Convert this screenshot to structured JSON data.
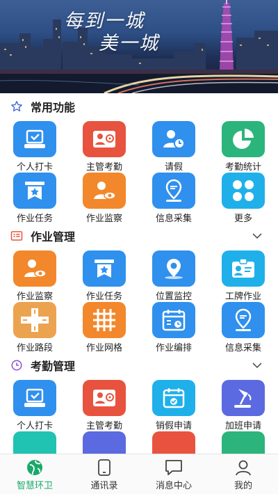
{
  "banner": {
    "slogan_line1": "每到一城",
    "slogan_line2": "美一城"
  },
  "sections": [
    {
      "title": "常用功能",
      "icon": "star-outline-icon",
      "collapsible": false,
      "items": [
        {
          "label": "个人打卡",
          "icon": "punch-in-icon",
          "color": "#2f90ee"
        },
        {
          "label": "主管考勤",
          "icon": "supervisor-attendance-icon",
          "color": "#e8533f"
        },
        {
          "label": "请假",
          "icon": "leave-request-icon",
          "color": "#2f90ee"
        },
        {
          "label": "考勤统计",
          "icon": "pie-chart-icon",
          "color": "#2bb47b"
        },
        {
          "label": "作业任务",
          "icon": "task-flag-icon",
          "color": "#2f90ee"
        },
        {
          "label": "作业监察",
          "icon": "inspection-icon",
          "color": "#f3872b"
        },
        {
          "label": "信息采集",
          "icon": "info-collect-icon",
          "color": "#2f90ee"
        },
        {
          "label": "更多",
          "icon": "more-grid-icon",
          "color": "#1fb0ea"
        }
      ]
    },
    {
      "title": "作业管理",
      "icon": "list-card-icon",
      "collapsible": true,
      "items": [
        {
          "label": "作业监察",
          "icon": "inspection-icon",
          "color": "#f3872b"
        },
        {
          "label": "作业任务",
          "icon": "task-flag-icon",
          "color": "#2f90ee"
        },
        {
          "label": "位置监控",
          "icon": "location-monitor-icon",
          "color": "#2f90ee"
        },
        {
          "label": "工牌作业",
          "icon": "badge-icon",
          "color": "#1fb0ea"
        },
        {
          "label": "作业路段",
          "icon": "road-section-icon",
          "color": "#eba350"
        },
        {
          "label": "作业网格",
          "icon": "grid-area-icon",
          "color": "#f3872b"
        },
        {
          "label": "作业编排",
          "icon": "schedule-icon",
          "color": "#2f90ee"
        },
        {
          "label": "信息采集",
          "icon": "info-collect-icon",
          "color": "#2f90ee"
        }
      ]
    },
    {
      "title": "考勤管理",
      "icon": "clock-outline-icon",
      "collapsible": true,
      "items": [
        {
          "label": "个人打卡",
          "icon": "punch-in-icon",
          "color": "#2f90ee"
        },
        {
          "label": "主管考勤",
          "icon": "supervisor-attendance-icon",
          "color": "#e8533f"
        },
        {
          "label": "销假申请",
          "icon": "cancel-leave-icon",
          "color": "#1fb0ea"
        },
        {
          "label": "加班申请",
          "icon": "overtime-lamp-icon",
          "color": "#5b6ae0"
        }
      ]
    }
  ],
  "tabbar": {
    "tabs": [
      {
        "label": "智慧环卫",
        "icon": "earth-leaf-icon",
        "active": true
      },
      {
        "label": "通讯录",
        "icon": "phone-book-icon",
        "active": false
      },
      {
        "label": "消息中心",
        "icon": "message-bubble-icon",
        "active": false
      },
      {
        "label": "我的",
        "icon": "user-profile-icon",
        "active": false
      }
    ]
  },
  "colors": {
    "active_tab": "#1aa96a",
    "section_accent": "#4a6fd8"
  }
}
